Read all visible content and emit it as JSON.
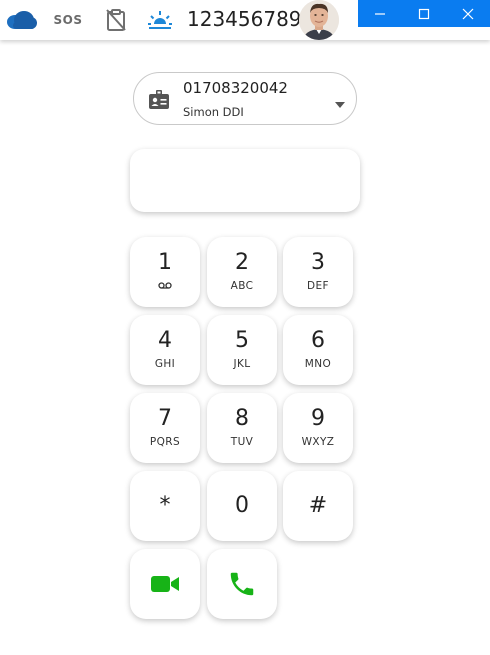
{
  "topbar": {
    "sos_label": "SOS",
    "extension": "123456789",
    "icons": [
      "cloud-icon",
      "sos-icon",
      "clipboard-off-icon",
      "sunrise-icon"
    ],
    "accent": "#1e88d8"
  },
  "window_controls": {
    "color": "#0a7cf0",
    "buttons": [
      "minimize",
      "maximize",
      "close"
    ]
  },
  "ddi": {
    "number": "01708320042",
    "name": "Simon DDI"
  },
  "display": {
    "value": ""
  },
  "keypad": {
    "keys": [
      {
        "digit": "1",
        "letters": ""
      },
      {
        "digit": "2",
        "letters": "ABC"
      },
      {
        "digit": "3",
        "letters": "DEF"
      },
      {
        "digit": "4",
        "letters": "GHI"
      },
      {
        "digit": "5",
        "letters": "JKL"
      },
      {
        "digit": "6",
        "letters": "MNO"
      },
      {
        "digit": "7",
        "letters": "PQRS"
      },
      {
        "digit": "8",
        "letters": "TUV"
      },
      {
        "digit": "9",
        "letters": "WXYZ"
      },
      {
        "digit": "*",
        "letters": ""
      },
      {
        "digit": "0",
        "letters": ""
      },
      {
        "digit": "#",
        "letters": ""
      }
    ],
    "call_color": "#17b317"
  }
}
